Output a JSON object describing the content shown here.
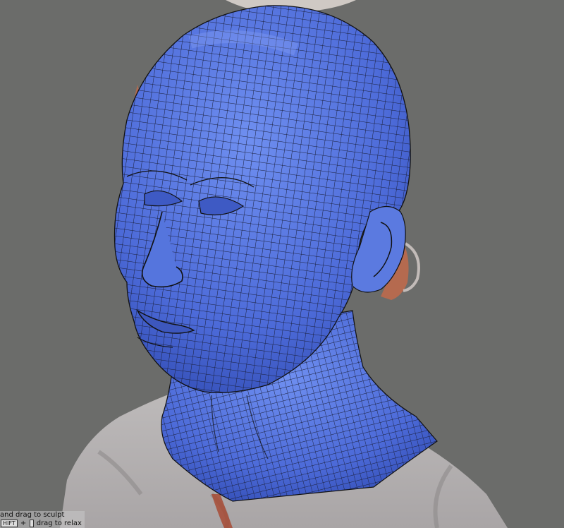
{
  "viewport": {
    "background_color": "#6b6c6a",
    "mesh_color": "#4e6fd6",
    "wire_color": "#111111",
    "scan_color": "#b9b6b6",
    "scan_edge_color": "#c26a4a"
  },
  "hints": {
    "sculpt_line": "and drag to sculpt",
    "relax_prefix_key": "HIFT",
    "relax_plus": "+",
    "relax_line": "drag to relax"
  }
}
